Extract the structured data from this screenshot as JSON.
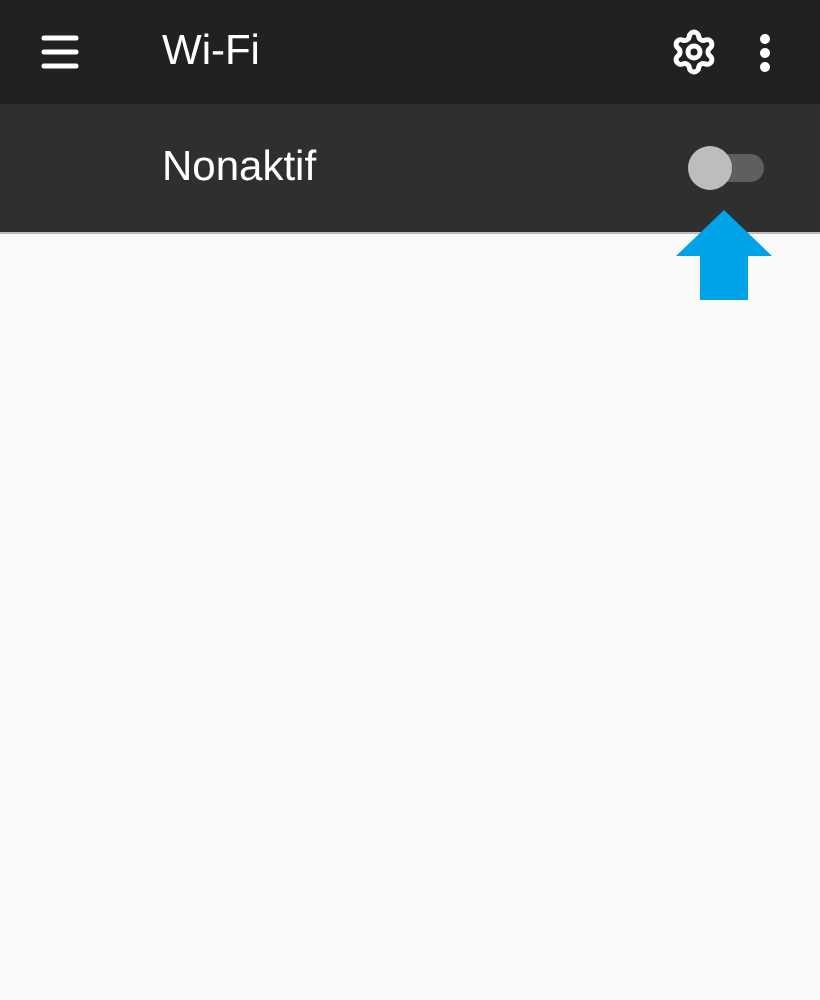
{
  "app_bar": {
    "title": "Wi-Fi"
  },
  "master_switch": {
    "label": "Nonaktif",
    "on": false
  }
}
